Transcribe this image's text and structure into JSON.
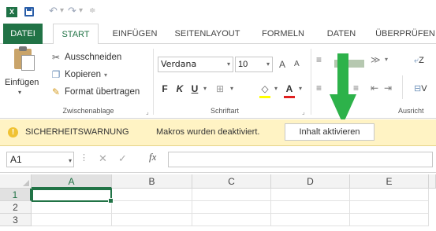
{
  "quick_access": {
    "app_icon": "excel-icon",
    "save_icon": "save-icon",
    "undo_icon": "undo-icon",
    "redo_icon": "redo-icon",
    "customize_icon": "customize-qat-icon"
  },
  "tabs": {
    "file": "DATEI",
    "start": "START",
    "insert": "EINFÜGEN",
    "page_layout": "SEITENLAYOUT",
    "formulas": "FORMELN",
    "data": "DATEN",
    "review": "ÜBERPRÜFEN"
  },
  "clipboard": {
    "paste": "Einfügen",
    "cut": "Ausschneiden",
    "copy": "Kopieren",
    "format_painter": "Format übertragen",
    "group_label": "Zwischenablage"
  },
  "font": {
    "name": "Verdana",
    "size": "10",
    "grow": "A",
    "shrink": "A",
    "bold": "F",
    "italic": "K",
    "underline": "U",
    "font_color_label": "A",
    "group_label": "Schriftart",
    "highlight_color": "#ffff00",
    "font_color": "#e02020"
  },
  "alignment": {
    "group_label": "Ausricht",
    "wrap_label": "Z",
    "merge_label": "V"
  },
  "security": {
    "title": "SICHERHEITSWARNUNG",
    "message": "Makros wurden deaktiviert.",
    "enable_button": "Inhalt aktivieren",
    "icon": "warning-icon"
  },
  "formula_bar": {
    "name_box": "A1",
    "fx": "fx",
    "formula": ""
  },
  "grid": {
    "columns": [
      "A",
      "B",
      "C",
      "D",
      "E"
    ],
    "rows": [
      "1",
      "2",
      "3"
    ],
    "active_cell": "A1"
  },
  "colors": {
    "accent": "#217346",
    "warning_bar": "#fff3c4",
    "arrow": "#2db24a"
  }
}
